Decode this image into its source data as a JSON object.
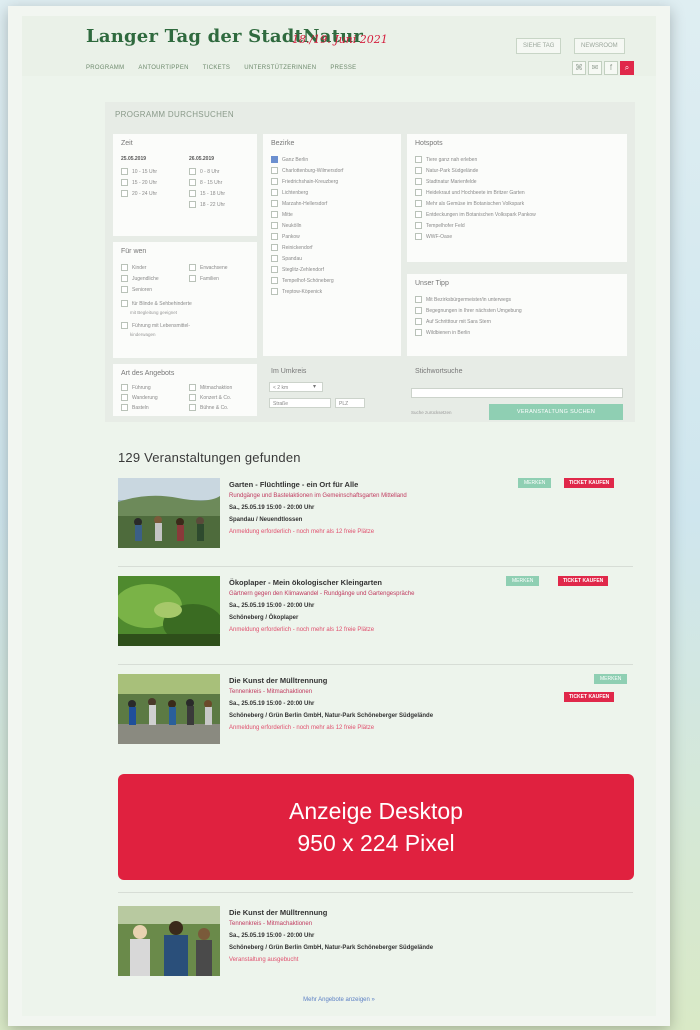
{
  "header": {
    "title": "Langer Tag der StadtNatur",
    "date": "18./19. Juni 2021",
    "buttons": [
      "SIEHE TAG",
      "NEWSROOM"
    ],
    "nav": [
      "PROGRAMM",
      "ANTOURTIPPEN",
      "TICKETS",
      "UNTERSTÜTZERINNEN",
      "PRESSE"
    ],
    "social": [
      "⌘",
      "✉",
      "f",
      "⌕"
    ]
  },
  "search": {
    "title": "PROGRAMM DURCHSUCHEN",
    "zeit": {
      "label": "Zeit",
      "day1": "25.05.2019",
      "day2": "26.05.2019",
      "day1_slots": [
        "10 - 15 Uhr",
        "15 - 20 Uhr",
        "20 - 24 Uhr"
      ],
      "day2_slots": [
        "0 - 8 Uhr",
        "8 - 15 Uhr",
        "15 - 18 Uhr",
        "18 - 22 Uhr"
      ]
    },
    "fuer_wen": {
      "label": "Für wen",
      "left": [
        "Kinder",
        "Jugendliche",
        "Senioren"
      ],
      "right": [
        "Erwachsene",
        "Familien"
      ],
      "extra": [
        "für Blinde & Sehbehinderte",
        "mit Begleitung geeignet",
        "Führung mit Lebensmittel-",
        "kinderwagen"
      ]
    },
    "art": {
      "label": "Art des Angebots",
      "left": [
        "Führung",
        "Wanderung",
        "Basteln"
      ],
      "right": [
        "Mitmachaktion",
        "Konzert & Co.",
        "Bühne & Co."
      ]
    },
    "bezirke": {
      "label": "Bezirke",
      "items": [
        "Ganz Berlin",
        "Charlottenburg-Wilmersdorf",
        "Friedrichshain-Kreuzberg",
        "Lichtenberg",
        "Marzahn-Hellersdorf",
        "Mitte",
        "Neukölln",
        "Pankow",
        "Reinickendorf",
        "Spandau",
        "Steglitz-Zehlendorf",
        "Tempelhof-Schöneberg",
        "Treptow-Köpenick"
      ]
    },
    "umkreis": {
      "label": "Im Umkreis",
      "select": "< 2 km",
      "street": "Straße",
      "plz": "PLZ"
    },
    "hotspots": {
      "label": "Hotspots",
      "items": [
        "Tiere ganz nah erleben",
        "Natur-Park Südgelände",
        "Stadtnatur Marienfelde",
        "Heidekraut und Hochbeete im Britzer Garten",
        "Mehr als Gemüse im Botanischen Volkspark",
        "Entdeckungen im Botanischen Volkspark Pankow",
        "Tempelhofer Feld",
        "WWF-Oase"
      ]
    },
    "tipp": {
      "label": "Unser Tipp",
      "items": [
        "Mit Bezirksbürgermeister/in unterwegs",
        "Begegnungen in Ihrer nächsten Umgebung",
        "Auf Schritttour mit Sara Stern",
        "Wildbienen in Berlin"
      ]
    },
    "stichwort": {
      "label": "Stichwortsuche",
      "reset": "Suche zurücksetzen",
      "submit": "VERANSTALTUNG SUCHEN"
    }
  },
  "results": {
    "count": "129 Veranstaltungen gefunden",
    "merken": "MERKEN",
    "ticket": "TICKET KAUFEN",
    "events": [
      {
        "title": "Garten - Flüchtlinge - ein Ort für Alle",
        "subtitle": "Rundgänge und Bastelaktionen im Gemeinschaftsgarten Mittelland",
        "date": "Sa., 25.05.19 15:00 - 20:00 Uhr",
        "location": "Spandau / Neuendtlossen",
        "note": "Anmeldung erforderlich - noch mehr als 12 freie Plätze"
      },
      {
        "title": "Ökoplaper - Mein ökologischer Kleingarten",
        "subtitle": "Gärtnern gegen den Klimawandel - Rundgänge und Gartengespräche",
        "date": "Sa., 25.05.19 15:00 - 20:00 Uhr",
        "location": "Schöneberg / Ökoplaper",
        "note": "Anmeldung erforderlich - noch mehr als 12 freie Plätze"
      },
      {
        "title": "Die Kunst der Mülltrennung",
        "subtitle": "Tennenkreis - Mitmachaktionen",
        "date": "Sa., 25.05.19 15:00 - 20:00 Uhr",
        "location": "Schöneberg / Grün Berlin GmbH, Natur-Park Schöneberger Südgelände",
        "note": "Anmeldung erforderlich - noch mehr als 12 freie Plätze"
      },
      {
        "title": "Die Kunst der Mülltrennung",
        "subtitle": "Tennenkreis - Mitmachaktionen",
        "date": "Sa., 25.05.19 15:00 - 20:00 Uhr",
        "location": "Schöneberg / Grün Berlin GmbH, Natur-Park Schöneberger Südgelände",
        "note": "Veranstaltung ausgebucht"
      }
    ]
  },
  "ad": {
    "line1": "Anzeige Desktop",
    "line2": "950 x 224 Pixel"
  },
  "more": "Mehr Angebote anzeigen »",
  "colors": {
    "brand_green": "#2f6a3e",
    "accent_red": "#e0213f",
    "mint": "#8fcfb3"
  }
}
